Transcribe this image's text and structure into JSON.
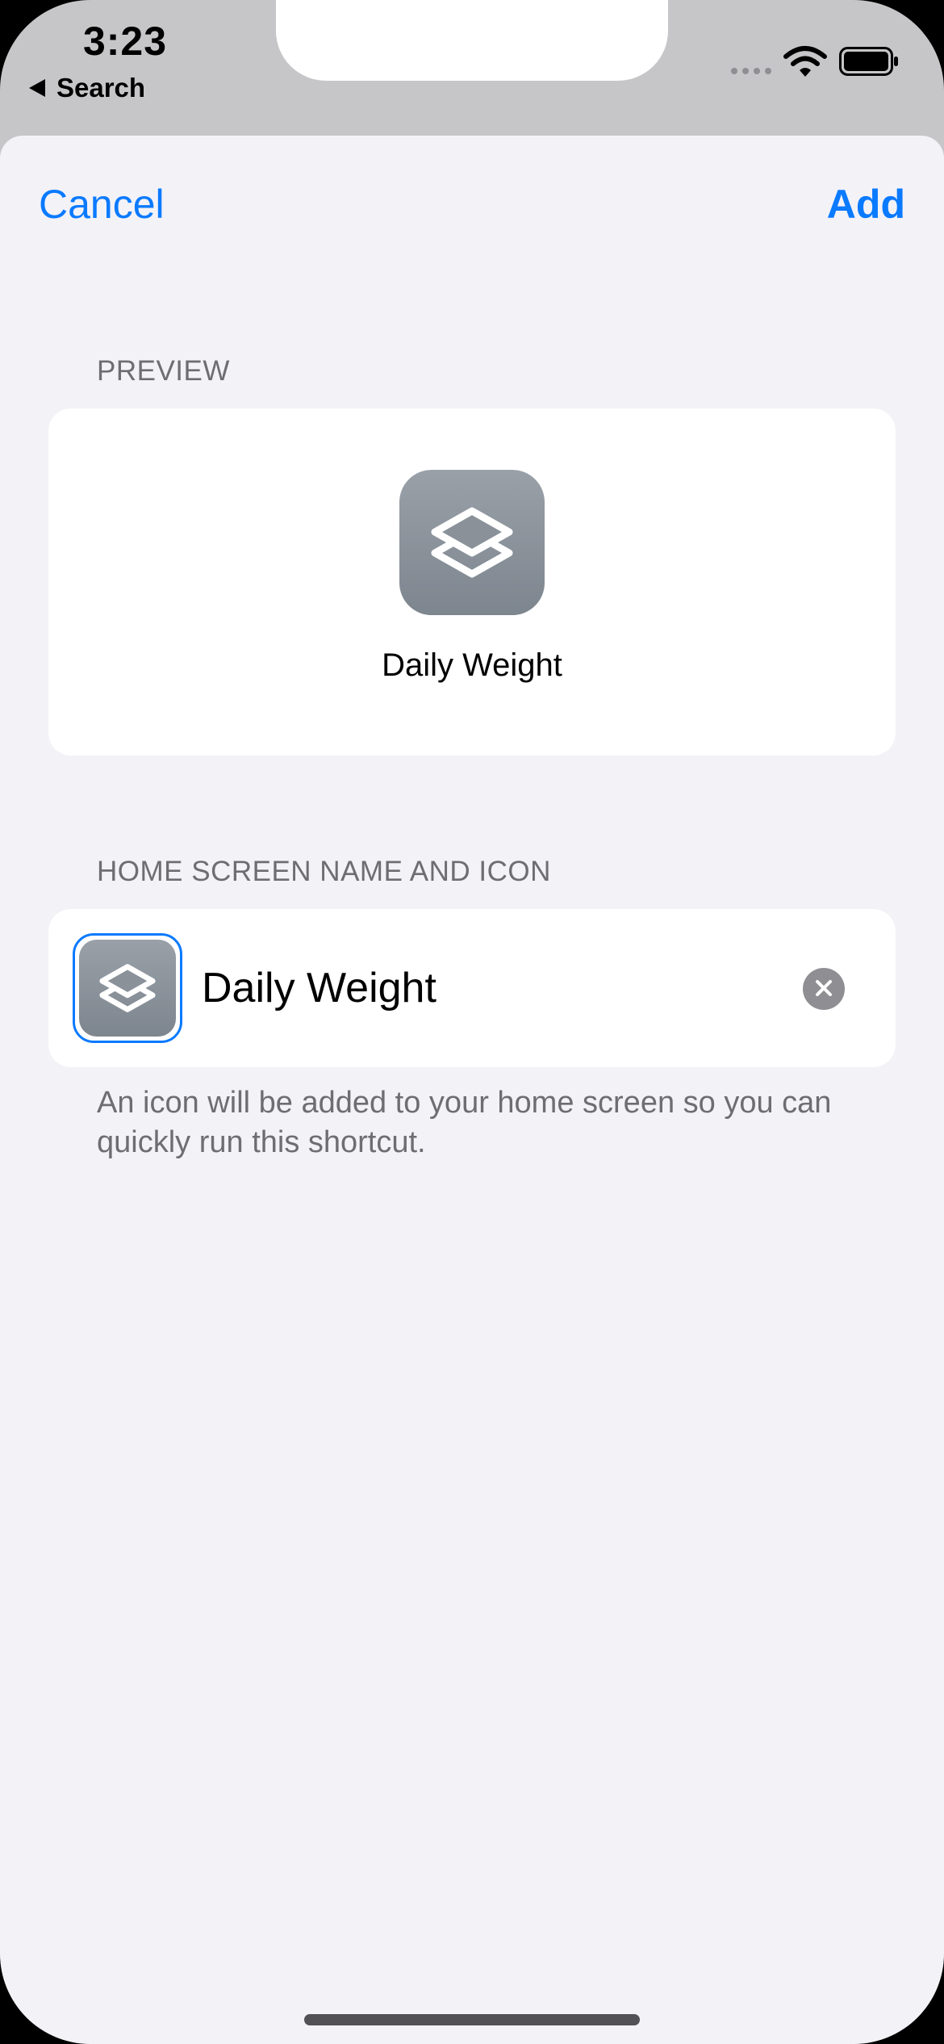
{
  "status_bar": {
    "time": "3:23",
    "back_label": "Search",
    "signal_icon": "cellular-signal-icon",
    "wifi_icon": "wifi-icon",
    "battery_icon": "battery-full-icon"
  },
  "nav": {
    "cancel_label": "Cancel",
    "add_label": "Add"
  },
  "preview": {
    "header": "PREVIEW",
    "icon": "shortcuts-layers-icon",
    "name": "Daily Weight"
  },
  "home_screen": {
    "header": "HOME SCREEN NAME AND ICON",
    "icon": "shortcuts-layers-icon",
    "name_value": "Daily Weight",
    "clear_icon": "clear-x-icon",
    "note": "An icon will be added to your home screen so you can quickly run this shortcut."
  },
  "colors": {
    "accent": "#0a7aff",
    "background": "#f2f2f7",
    "icon_gray": "#8a9199",
    "secondary_text": "#6d6d72"
  }
}
